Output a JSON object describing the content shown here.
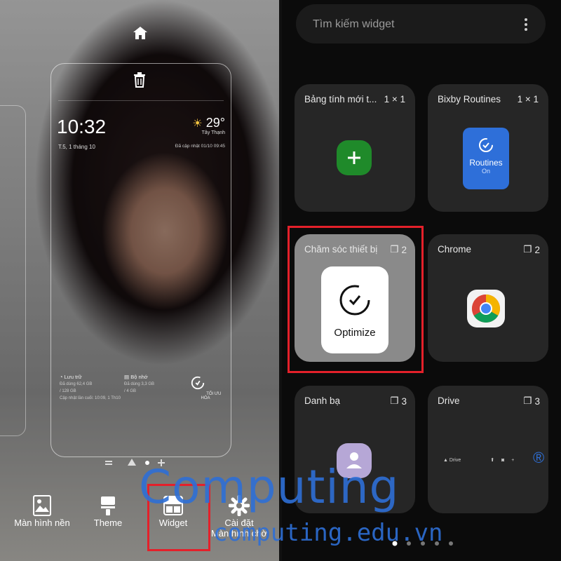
{
  "left": {
    "preview": {
      "time": "10:32",
      "date": "T.5, 1 tháng 10",
      "temperature": "29°",
      "location": "Tây Thạnh",
      "updated": "Đã cập nhật 01/10 09:45",
      "storage_label": "Lưu trữ",
      "storage_used": "Đã dùng 62,4 GB",
      "storage_total": "/ 128 GB",
      "memory_label": "Bộ nhớ",
      "memory_used": "Đã dùng 3,3 GB",
      "memory_total": "/ 4 GB",
      "last_update": "Cập nhật lần cuối: 10:09, 1 Th10",
      "optimize_label": "TỐI ƯU HÓA"
    },
    "nav": [
      {
        "label": "Màn hình nền",
        "icon": "image-icon"
      },
      {
        "label": "Theme",
        "icon": "brush-icon"
      },
      {
        "label": "Widget",
        "icon": "widget-icon"
      },
      {
        "label_line1": "Cài đặt",
        "label_line2": "Màn hình chờ",
        "icon": "gear-icon"
      }
    ]
  },
  "right": {
    "search_placeholder": "Tìm kiếm widget",
    "widgets": [
      {
        "title": "Bảng tính mới t...",
        "size": "1 × 1"
      },
      {
        "title": "Bixby Routines",
        "size": "1 × 1",
        "tile_label": "Routines",
        "tile_sub": "On"
      },
      {
        "title": "Chăm sóc thiết bị",
        "count": "2",
        "tile_label": "Optimize"
      },
      {
        "title": "Chrome",
        "count": "2"
      },
      {
        "title": "Danh bạ",
        "count": "3"
      },
      {
        "title": "Drive",
        "count": "3",
        "bar_label": "Drive"
      }
    ]
  },
  "watermark": {
    "brand": "Computing",
    "reg": "®",
    "url": "computing.edu.vn"
  },
  "colors": {
    "highlight": "#e4202a",
    "routines_blue": "#2e6fd9",
    "plus_green": "#1f8a2a",
    "watermark_blue": "#2e6fd6"
  }
}
